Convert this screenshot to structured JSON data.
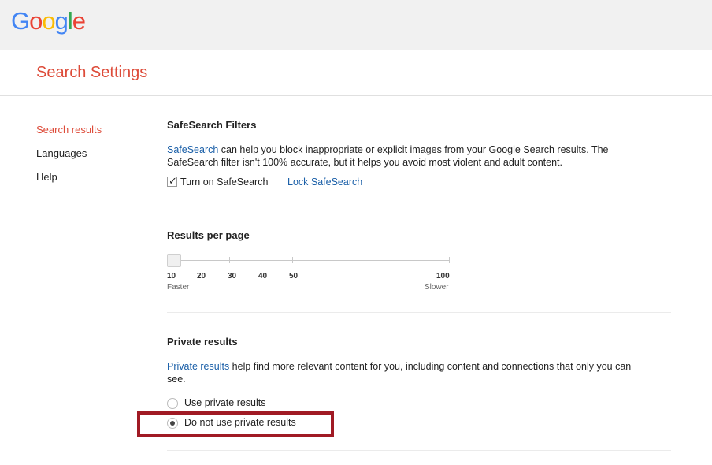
{
  "header": {
    "logo_letters": [
      {
        "char": "G",
        "color": "#4285F4"
      },
      {
        "char": "o",
        "color": "#EA4335"
      },
      {
        "char": "o",
        "color": "#FBBC05"
      },
      {
        "char": "g",
        "color": "#4285F4"
      },
      {
        "char": "l",
        "color": "#34A853"
      },
      {
        "char": "e",
        "color": "#EA4335"
      }
    ]
  },
  "page_title": "Search Settings",
  "sidebar": {
    "items": [
      {
        "label": "Search results",
        "active": true
      },
      {
        "label": "Languages",
        "active": false
      },
      {
        "label": "Help",
        "active": false
      }
    ]
  },
  "safesearch": {
    "title": "SafeSearch Filters",
    "link_text": "SafeSearch",
    "desc_line1_rest": " can help you block inappropriate or explicit images from your Google Search results. The",
    "desc_line2": "SafeSearch filter isn't 100% accurate, but it helps you avoid most violent and adult content.",
    "checkbox_label": "Turn on SafeSearch",
    "checkbox_checked": true,
    "lock_link": "Lock SafeSearch"
  },
  "results_per_page": {
    "title": "Results per page",
    "ticks": [
      "10",
      "20",
      "30",
      "40",
      "50",
      "100"
    ],
    "selected_value": "10",
    "faster_label": "Faster",
    "slower_label": "Slower"
  },
  "private_results": {
    "title": "Private results",
    "link_text": "Private results",
    "desc_line1_rest": " help find more relevant content for you, including content and connections that only you can",
    "desc_line2": "see.",
    "options": [
      {
        "label": "Use private results",
        "selected": false
      },
      {
        "label": "Do not use private results",
        "selected": true
      }
    ]
  },
  "colors": {
    "accent_red": "#dd4b39",
    "link_blue": "#1a5fa8",
    "highlight_border": "#a01a24"
  }
}
